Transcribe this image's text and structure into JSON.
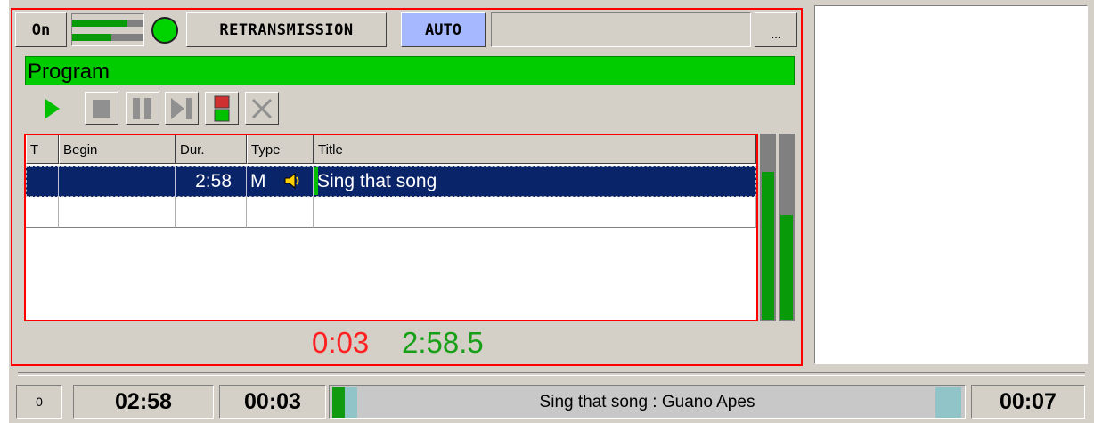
{
  "header": {
    "on_label": "On",
    "retransmission_label": "RETRANSMISSION",
    "auto_label": "AUTO",
    "more_label": "...",
    "level_meter": {
      "upper_level": 0.78,
      "lower_level": 0.55
    },
    "status_led_color": "#00d400"
  },
  "program_label": "Program",
  "colors": {
    "program_bar": "#00cc00",
    "selection": "#0a246a",
    "auto_bg": "#a6b8ff",
    "elapsed": "#ff2020",
    "remaining": "#17a017"
  },
  "toolbar": {
    "buttons": [
      "play-icon",
      "stop-icon",
      "pause-icon",
      "next-icon",
      "split-icon",
      "delete-icon"
    ]
  },
  "playlist": {
    "columns": [
      "T",
      "Begin",
      "Dur.",
      "Type",
      "Title"
    ],
    "rows": [
      {
        "t": "",
        "begin": "",
        "dur": "2:58",
        "type": "M",
        "type_icon": "speaker-icon",
        "title": "Sing that song"
      },
      {
        "t": "",
        "begin": "",
        "dur": "",
        "type": "",
        "title": ""
      }
    ]
  },
  "vu_meters": {
    "left_level": 0.8,
    "right_level": 0.57
  },
  "times": {
    "elapsed": "0:03",
    "remaining": "2:58.5"
  },
  "statusbar": {
    "index": "0",
    "duration": "02:58",
    "position": "00:03",
    "now_playing": "Sing that song : Guano Apes",
    "remaining": "00:07"
  }
}
